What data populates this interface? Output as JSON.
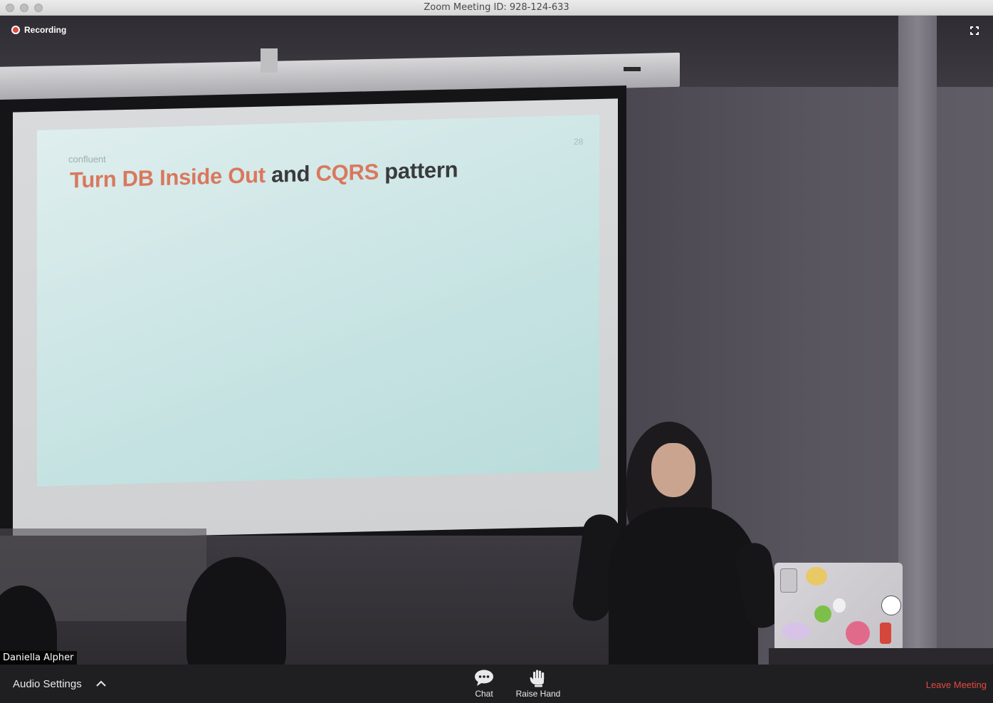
{
  "window": {
    "title": "Zoom Meeting ID: 928-124-633"
  },
  "overlay": {
    "recording_label": "Recording",
    "fullscreen_icon": "fullscreen-icon",
    "participant_name": "Daniella Alpher"
  },
  "slide": {
    "logo_text": "confluent",
    "page_number": "28",
    "title_part1": "Turn DB Inside Out",
    "title_part2": " and ",
    "title_part3": "CQRS",
    "title_part4": " pattern"
  },
  "toolbar": {
    "audio_settings_label": "Audio Settings",
    "chat_label": "Chat",
    "raise_hand_label": "Raise Hand",
    "leave_label": "Leave Meeting"
  },
  "colors": {
    "accent_slide": "#d9785d",
    "leave": "#e44a3f",
    "recording_dot": "#e0483f",
    "toolbar_bg": "#1f1f21"
  }
}
